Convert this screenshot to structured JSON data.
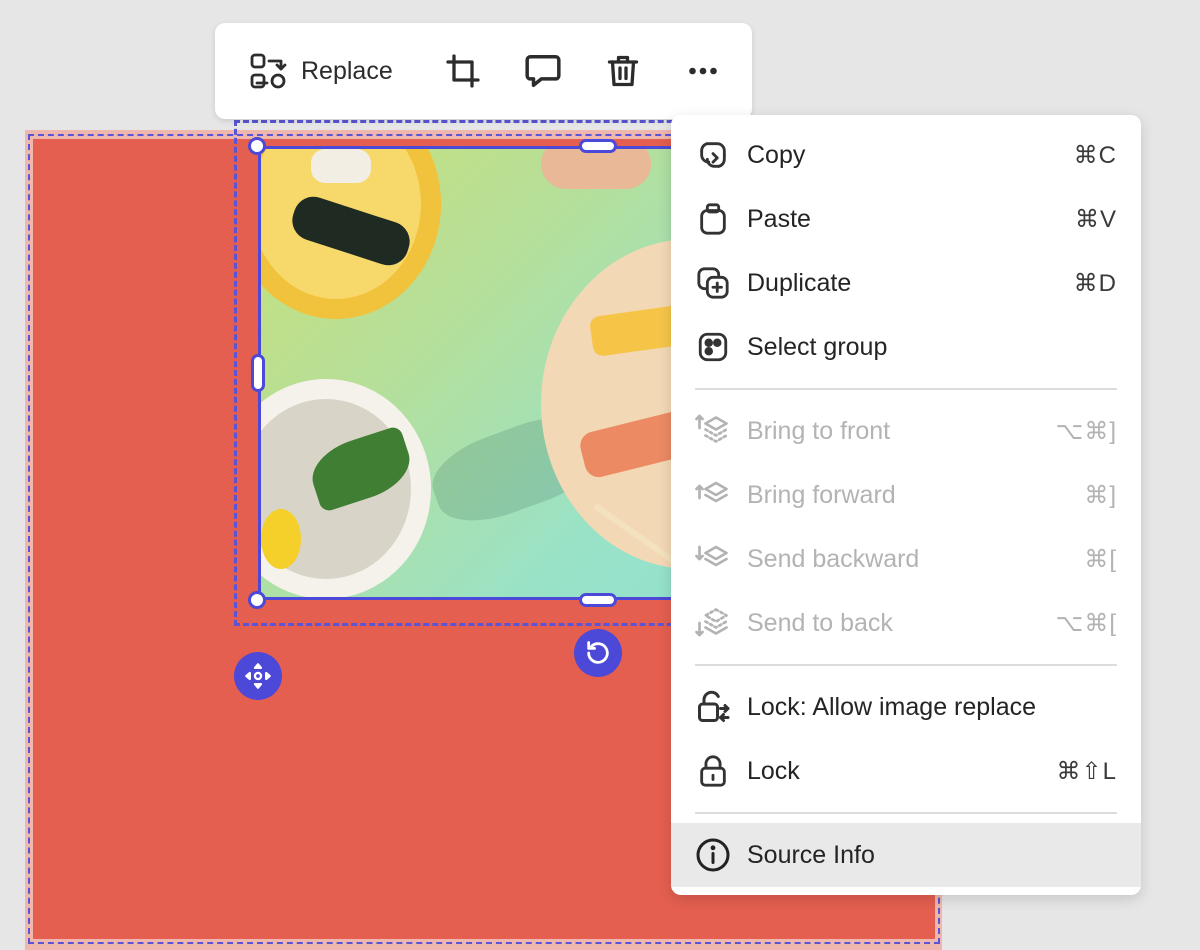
{
  "toolbar": {
    "replace_label": "Replace",
    "icons": [
      "replace-icon",
      "crop-icon",
      "comment-icon",
      "trash-icon",
      "more-icon"
    ]
  },
  "menu": {
    "groups": [
      [
        {
          "label": "Copy",
          "shortcut": "⌘C",
          "icon": "copy-icon",
          "enabled": true
        },
        {
          "label": "Paste",
          "shortcut": "⌘V",
          "icon": "paste-icon",
          "enabled": true
        },
        {
          "label": "Duplicate",
          "shortcut": "⌘D",
          "icon": "duplicate-icon",
          "enabled": true
        },
        {
          "label": "Select group",
          "shortcut": "",
          "icon": "select-group-icon",
          "enabled": true
        }
      ],
      [
        {
          "label": "Bring to front",
          "shortcut": "⌥⌘]",
          "icon": "bring-to-front-icon",
          "enabled": false
        },
        {
          "label": "Bring forward",
          "shortcut": "⌘]",
          "icon": "bring-forward-icon",
          "enabled": false
        },
        {
          "label": "Send backward",
          "shortcut": "⌘[",
          "icon": "send-backward-icon",
          "enabled": false
        },
        {
          "label": "Send to back",
          "shortcut": "⌥⌘[",
          "icon": "send-to-back-icon",
          "enabled": false
        }
      ],
      [
        {
          "label": "Lock: Allow image replace",
          "shortcut": "",
          "icon": "lock-replace-icon",
          "enabled": true
        },
        {
          "label": "Lock",
          "shortcut": "⌘⇧L",
          "icon": "lock-icon",
          "enabled": true
        }
      ],
      [
        {
          "label": "Source Info",
          "shortcut": "",
          "icon": "info-icon",
          "enabled": true,
          "highlighted": true
        }
      ]
    ]
  },
  "colors": {
    "accent": "#4c48d8",
    "shape_fill": "#e45f4f",
    "disabled_text": "#b3b3b3"
  }
}
